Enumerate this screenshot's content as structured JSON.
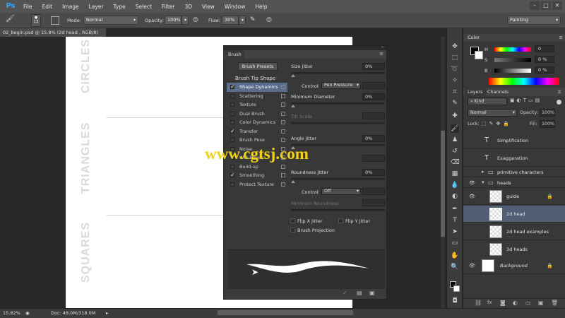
{
  "app": {
    "logo": "Ps"
  },
  "menu": [
    "File",
    "Edit",
    "Image",
    "Layer",
    "Type",
    "Select",
    "Filter",
    "3D",
    "View",
    "Window",
    "Help"
  ],
  "options": {
    "brush_size": "13",
    "mode_label": "Mode:",
    "mode_value": "Normal",
    "opacity_label": "Opacity:",
    "opacity_value": "100%",
    "flow_label": "Flow:",
    "flow_value": "30%",
    "workspace": "Painting"
  },
  "doc_tab": "02_begin.psd @ 15.8% (2d head , RGB/8) *",
  "canvas": {
    "labels": [
      "CIRCLES",
      "TRIANGLES",
      "SQUARES"
    ]
  },
  "watermark": "www.cgtsj.com",
  "brush_panel": {
    "tab": "Brush",
    "presets_button": "Brush Presets",
    "section_title": "Brush Tip Shape",
    "items": [
      {
        "label": "Shape Dynamics",
        "checked": true,
        "selected": true
      },
      {
        "label": "Scattering",
        "checked": false
      },
      {
        "label": "Texture",
        "checked": false
      },
      {
        "label": "Dual Brush",
        "checked": false
      },
      {
        "label": "Color Dynamics",
        "checked": false
      },
      {
        "label": "Transfer",
        "checked": true
      },
      {
        "label": "Brush Pose",
        "checked": false
      },
      {
        "label": "Noise",
        "checked": false
      },
      {
        "label": "Wet Edges",
        "checked": false
      },
      {
        "label": "Build-up",
        "checked": false
      },
      {
        "label": "Smoothing",
        "checked": true
      },
      {
        "label": "Protect Texture",
        "checked": false
      }
    ],
    "size_jitter": {
      "label": "Size Jitter",
      "value": "0%"
    },
    "control1": {
      "label": "Control:",
      "value": "Pen Pressure"
    },
    "min_diameter": {
      "label": "Minimum Diameter",
      "value": "0%"
    },
    "tilt_scale": "Tilt Scale",
    "angle_jitter": {
      "label": "Angle Jitter",
      "value": "0%"
    },
    "roundness_jitter": {
      "label": "Roundness Jitter",
      "value": "0%"
    },
    "control2": {
      "label": "Control:",
      "value": "Off"
    },
    "min_roundness": "Minimum Roundness",
    "flip_x": "Flip X Jitter",
    "flip_y": "Flip Y Jitter",
    "brush_projection": "Brush Projection"
  },
  "color_panel": {
    "title": "Color",
    "rows": [
      {
        "ch": "H",
        "value": "0"
      },
      {
        "ch": "S",
        "value": "0 %"
      },
      {
        "ch": "B",
        "value": "0 %"
      }
    ]
  },
  "layers_panel": {
    "tabs": [
      "Layers",
      "Channels"
    ],
    "kind": "Kind",
    "blend": "Normal",
    "opacity_label": "Opacity:",
    "opacity_value": "100%",
    "lock_label": "Lock:",
    "fill_label": "Fill:",
    "fill_value": "100%",
    "layers": [
      {
        "name": "Simplification",
        "type": "text"
      },
      {
        "name": "Exaggeration",
        "type": "text"
      },
      {
        "name": "primitive characters",
        "type": "group"
      },
      {
        "name": "heads",
        "type": "group"
      },
      {
        "name": "guide",
        "type": "pixel"
      },
      {
        "name": "2d head",
        "type": "pixel"
      },
      {
        "name": "2d head examples",
        "type": "pixel"
      },
      {
        "name": "3d heads",
        "type": "pixel"
      },
      {
        "name": "Background",
        "type": "background"
      }
    ]
  },
  "status": {
    "zoom": "15.82%",
    "doc": "Doc: 48.0M/318.0M"
  }
}
